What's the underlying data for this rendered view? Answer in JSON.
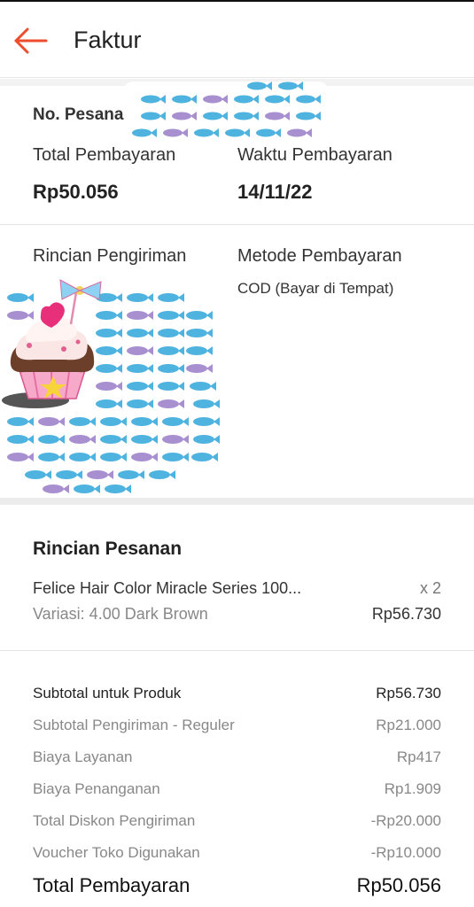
{
  "header": {
    "title": "Faktur",
    "accent": "#ee4d2d"
  },
  "invoice": {
    "order_no_label": "No. Pesanan",
    "total_label": "Total Pembayaran",
    "total_value": "Rp50.056",
    "time_label": "Waktu Pembayaran",
    "time_value": "14/11/22",
    "shipping_label": "Rincian Pengiriman",
    "method_label": "Metode Pembayaran",
    "method_value": "COD (Bayar di Tempat)"
  },
  "order": {
    "title": "Rincian Pesanan",
    "product_name": "Felice Hair Color Miracle Series 100...",
    "quantity": "x 2",
    "variation": "Variasi: 4.00 Dark Brown",
    "price": "Rp56.730"
  },
  "summary": {
    "rows": [
      {
        "label": "Subtotal untuk Produk",
        "value": "Rp56.730"
      },
      {
        "label": "Subtotal Pengiriman - Reguler",
        "value": "Rp21.000"
      },
      {
        "label": "Biaya Layanan",
        "value": "Rp417"
      },
      {
        "label": "Biaya Penanganan",
        "value": "Rp1.909"
      },
      {
        "label": "Total Diskon Pengiriman",
        "value": "-Rp20.000"
      },
      {
        "label": "Voucher Toko Digunakan",
        "value": "-Rp10.000"
      }
    ],
    "total_label": "Total Pembayaran",
    "total_value": "Rp50.056"
  }
}
